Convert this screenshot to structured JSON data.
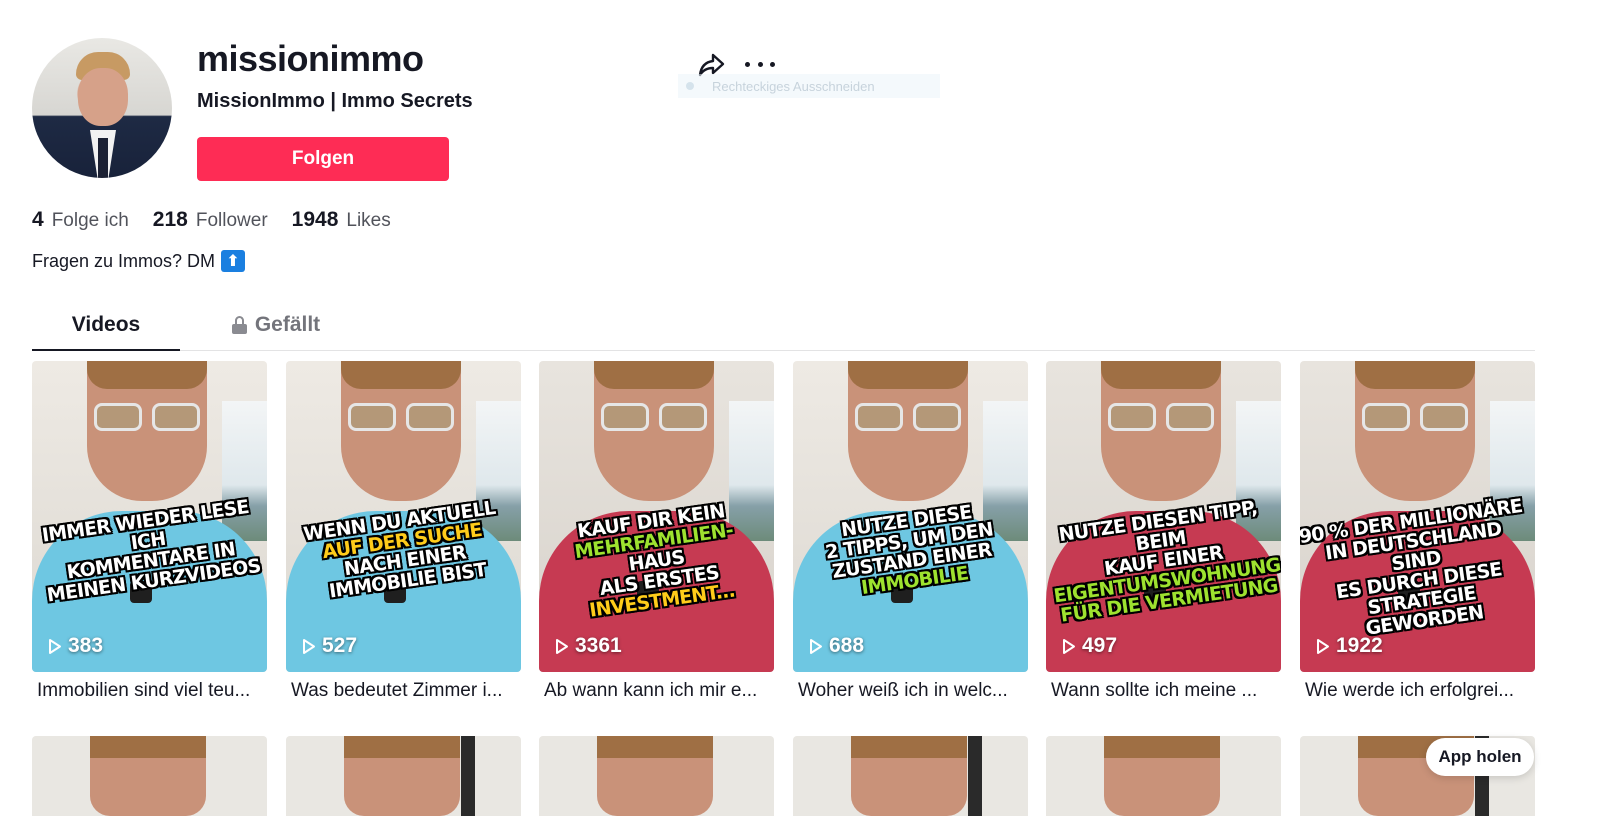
{
  "profile": {
    "username": "missionimmo",
    "nickname": "MissionImmo | Immo Secrets",
    "follow_label": "Folgen",
    "bio": "Fragen zu Immos? DM",
    "bio_emoji": "⬆"
  },
  "header": {
    "tooltip": "Rechteckiges Ausschneiden"
  },
  "stats": [
    {
      "num": "4",
      "label": "Folge ich"
    },
    {
      "num": "218",
      "label": "Follower"
    },
    {
      "num": "1948",
      "label": "Likes"
    }
  ],
  "tabs": [
    {
      "label": "Videos"
    },
    {
      "label": "Gefällt"
    }
  ],
  "videos": [
    {
      "views": "383",
      "desc": "Immobilien sind viel teu...",
      "shirt": "#6ec7e2",
      "caption_lines": [
        "IMMER WIEDER LESE ICH",
        "KOMMENTARE IN",
        "MEINEN KURZVIDEOS"
      ]
    },
    {
      "views": "527",
      "desc": "Was bedeutet Zimmer i...",
      "shirt": "#6ec7e2",
      "caption_lines": [
        "WENN DU AKTUELL",
        "AUF DER SUCHE",
        "NACH EINER",
        "IMMOBILIE BIST"
      ]
    },
    {
      "views": "3361",
      "desc": "Ab wann kann ich mir e...",
      "shirt": "#c63a52",
      "caption_lines": [
        "KAUF DIR KEIN",
        "MEHRFAMILIEN-",
        "HAUS",
        "ALS ERSTES",
        "INVESTMENT..."
      ]
    },
    {
      "views": "688",
      "desc": "Woher weiß ich in welc...",
      "shirt": "#6ec7e2",
      "caption_lines": [
        "NUTZE DIESE",
        "2 TIPPS, UM DEN",
        "ZUSTAND EINER",
        "IMMOBILIE"
      ]
    },
    {
      "views": "497",
      "desc": "Wann sollte ich meine ...",
      "shirt": "#c63a52",
      "caption_lines": [
        "NUTZE DIESEN TIPP, BEIM",
        "KAUF EINER",
        "EIGENTUMSWOHNUNG",
        "FÜR DIE VERMIETUNG"
      ]
    },
    {
      "views": "1922",
      "desc": "Wie werde ich erfolgrei...",
      "shirt": "#c63a52",
      "caption_lines": [
        "90 % DER MILLIONÄRE",
        "IN DEUTSCHLAND SIND",
        "ES DURCH DIESE",
        "STRATEGIE GEWORDEN"
      ]
    }
  ],
  "app_button": "App holen",
  "icons": {
    "share": "share-icon",
    "more": "more-icon",
    "lock": "lock-icon",
    "play": "play-icon"
  },
  "colors": {
    "accent": "#fe2c55",
    "text": "#161823"
  }
}
